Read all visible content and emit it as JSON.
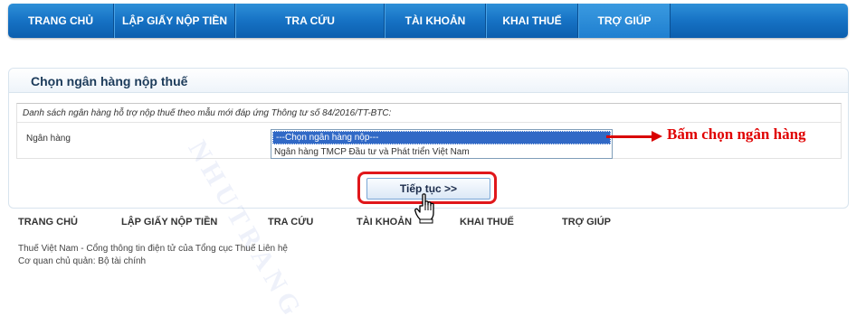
{
  "top_nav": {
    "tabs": [
      {
        "label": "TRANG CHỦ"
      },
      {
        "label": "LẬP GIẤY NỘP TIỀN"
      },
      {
        "label": "TRA CỨU"
      },
      {
        "label": "TÀI KHOẢN"
      },
      {
        "label": "KHAI THUẾ"
      },
      {
        "label": "TRỢ GIÚP",
        "active": true
      }
    ]
  },
  "panel": {
    "title": "Chọn ngân hàng nộp thuế",
    "notice": "Danh sách ngân hàng hỗ trợ nộp thuế theo mẫu mới đáp ứng Thông tư số 84/2016/TT-BTC:",
    "bank_label": "Ngân hàng",
    "bank_options": [
      {
        "label": "---Chọn ngân hàng nộp---",
        "selected": true
      },
      {
        "label": "Ngân hàng TMCP Đầu tư và Phát triển Việt Nam",
        "selected": false
      }
    ],
    "continue_label": "Tiếp tục >>"
  },
  "annotation": {
    "text": "Bấm chọn ngân hàng",
    "color": "#e00000"
  },
  "footer_nav": {
    "items": [
      {
        "label": "TRANG CHỦ"
      },
      {
        "label": "LẬP GIẤY NỘP TIỀN"
      },
      {
        "label": "TRA CỨU"
      },
      {
        "label": "TÀI KHOẢN"
      },
      {
        "label": "KHAI THUẾ"
      },
      {
        "label": "TRỢ GIÚP"
      }
    ]
  },
  "footer": {
    "line1": "Thuế Việt Nam - Cổng thông tin điện tử của Tổng cục Thuế Liên hệ",
    "line2": "Cơ quan chủ quản: Bộ tài chính"
  },
  "watermark": "NHUTRANG",
  "colors": {
    "nav_blue": "#1672c4",
    "selection_blue": "#3169c6",
    "highlight_red": "#e0171b"
  },
  "icons": {
    "cursor": "hand-pointer-icon",
    "arrow": "arrow-right-icon"
  }
}
